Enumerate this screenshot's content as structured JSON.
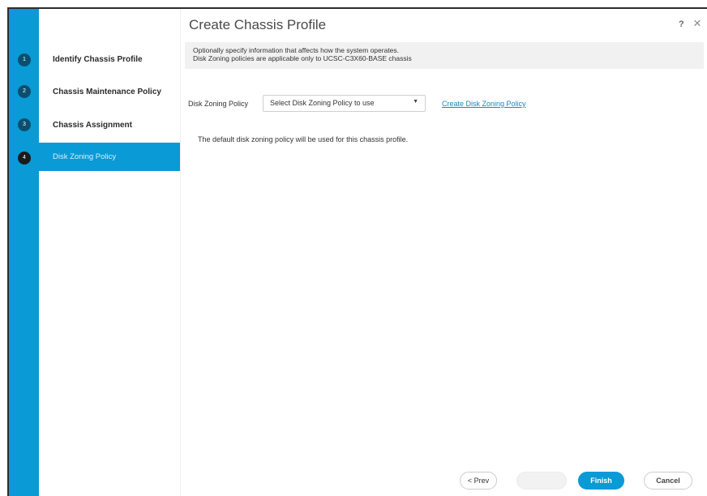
{
  "dialog": {
    "title": "Create Chassis Profile",
    "help": "?",
    "close": "×"
  },
  "steps": [
    {
      "number": "1",
      "label": "Identify Chassis Profile"
    },
    {
      "number": "2",
      "label": "Chassis Maintenance Policy"
    },
    {
      "number": "3",
      "label": "Chassis Assignment"
    },
    {
      "number": "4",
      "label": "Disk Zoning Policy",
      "active": true
    }
  ],
  "info": {
    "line1": "Optionally specify information that affects how the system operates.",
    "line2": "Disk Zoning policies are applicable only to UCSC-C3X60-BASE chassis"
  },
  "disk_zoning": {
    "label": "Disk Zoning Policy",
    "selected": "Select Disk Zoning Policy to use",
    "create_link": "Create Disk Zoning Policy",
    "note": "The default disk zoning policy will be used for this chassis profile."
  },
  "footer": {
    "prev": "< Prev",
    "next": "",
    "finish": "Finish",
    "cancel": "Cancel"
  },
  "colors": {
    "accent": "#0a9ad6"
  }
}
